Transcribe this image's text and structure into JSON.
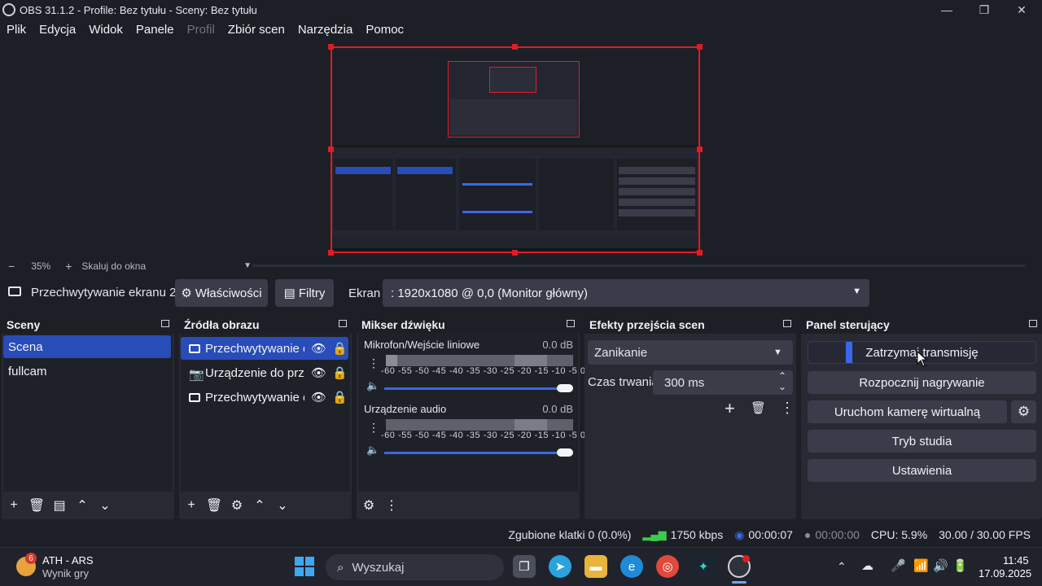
{
  "window": {
    "title": "OBS 31.1.2 - Profile: Bez tytułu - Sceny: Bez tytułu"
  },
  "menu": [
    "Plik",
    "Edycja",
    "Widok",
    "Panele",
    "Profil",
    "Zbiór scen",
    "Narzędzia",
    "Pomoc"
  ],
  "zoom": {
    "level": "35%",
    "mode": "Skaluj do okna",
    "minus": "−",
    "plus": "+"
  },
  "source_toolbar": {
    "source_name": "Przechwytywanie ekranu 2",
    "properties_label": "Właściwości",
    "filters_label": "Filtry",
    "screen_label": "Ekran",
    "screen_value": ": 1920x1080 @ 0,0 (Monitor główny)"
  },
  "scenes": {
    "title": "Sceny",
    "items": [
      "Scena",
      "fullcam"
    ]
  },
  "sources": {
    "title": "Źródła obrazu",
    "items": [
      "Przechwytywanie ek",
      "Urządzenie do przec",
      "Przechwytywanie ek"
    ]
  },
  "mixer": {
    "title": "Mikser dźwięku",
    "channels": [
      {
        "name": "Mikrofon/Wejście liniowe",
        "db": "0.0 dB",
        "level": 0.06
      },
      {
        "name": "Urządzenie audio",
        "db": "0.0 dB",
        "level": 0.0
      }
    ],
    "ticks": "-60 -55 -50 -45 -40 -35 -30 -25 -20 -15 -10  -5   0"
  },
  "transitions": {
    "title": "Efekty przejścia scen",
    "selected": "Zanikanie",
    "duration_label": "Czas trwania",
    "duration_value": "300 ms"
  },
  "controls": {
    "title": "Panel sterujący",
    "buttons": [
      "Zatrzymaj transmisję",
      "Rozpocznij nagrywanie",
      "Uruchom kamerę wirtualną",
      "Tryb studia",
      "Ustawienia"
    ]
  },
  "status": {
    "dropped": "Zgubione klatki 0 (0.0%)",
    "bitrate": "1750 kbps",
    "stream_time": "00:00:07",
    "rec_time": "00:00:00",
    "cpu": "CPU: 5.9%",
    "fps": "30.00 / 30.00 FPS"
  },
  "taskbar": {
    "widget_title": "ATH - ARS",
    "widget_sub": "Wynik gry",
    "widget_badge": "6",
    "search": "Wyszukaj",
    "time": "11:45",
    "date": "17.09.2025"
  },
  "colors": {
    "accent": "#284cb8",
    "selection_border": "#e01b24",
    "slider": "#3a67ea"
  }
}
